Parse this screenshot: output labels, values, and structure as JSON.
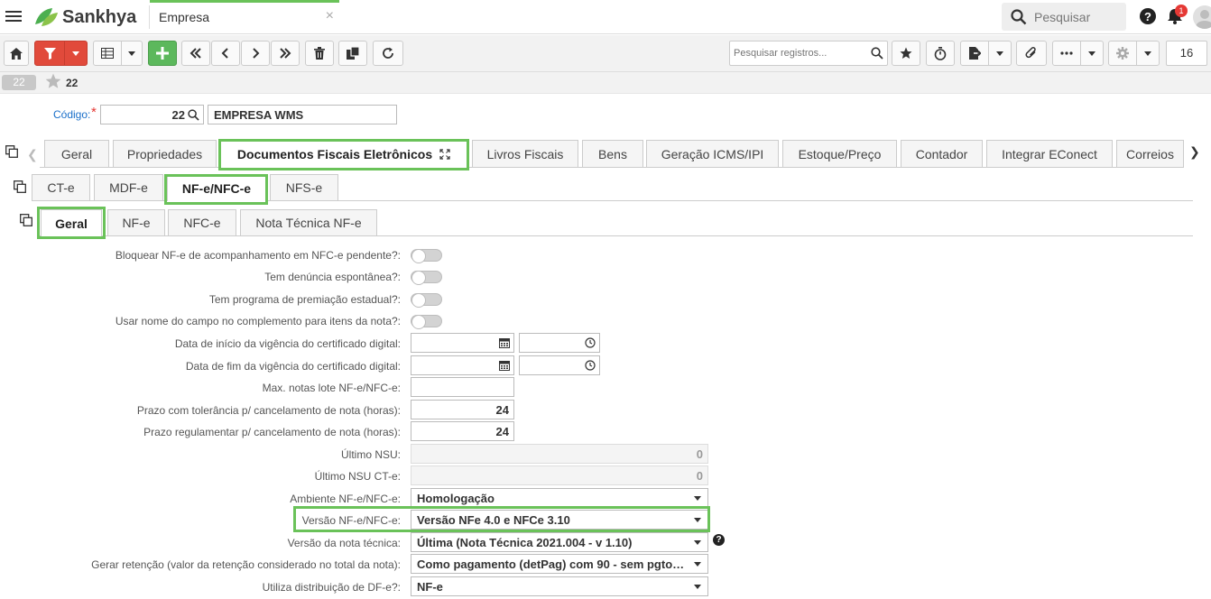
{
  "header": {
    "brand": "Sankhya",
    "page_title": "Empresa",
    "close_glyph": "×",
    "search_placeholder": "Pesquisar",
    "notification_count": "1",
    "accent_color": "#6ac259"
  },
  "toolbar": {
    "record_search_placeholder": "Pesquisar registros...",
    "page_number": "16",
    "icons": [
      "home-icon",
      "filter-icon",
      "grid-icon",
      "add-icon",
      "first-icon",
      "previous-icon",
      "next-icon",
      "last-icon",
      "delete-icon",
      "duplicate-icon",
      "refresh-icon",
      "search-icon",
      "star-icon",
      "timer-icon",
      "export-icon",
      "attachment-icon",
      "more-icon",
      "gear-icon"
    ]
  },
  "record": {
    "badge": "22",
    "favorite_label": "22"
  },
  "codigo": {
    "label": "Código:",
    "required_mark": "*",
    "value": "22",
    "description": "EMPRESA WMS"
  },
  "tabs": {
    "main": [
      "Geral",
      "Propriedades",
      "Documentos Fiscais Eletrônicos",
      "Livros Fiscais",
      "Bens",
      "Geração ICMS/IPI",
      "Estoque/Preço",
      "Contador",
      "Integrar EConect",
      "Correios"
    ],
    "docs": [
      "CT-e",
      "MDF-e",
      "NF-e/NFC-e",
      "NFS-e"
    ],
    "nfe": [
      "Geral",
      "NF-e",
      "NFC-e",
      "Nota Técnica NF-e"
    ]
  },
  "form": {
    "bloquear_label": "Bloquear NF-e de acompanhamento em NFC-e pendente?:",
    "denuncia_label": "Tem denúncia espontânea?:",
    "premiacao_label": "Tem programa de premiação estadual?:",
    "nome_campo_label": "Usar nome do campo no complemento para itens da nota?:",
    "data_inicio_label": "Data de início da vigência do certificado digital:",
    "data_fim_label": "Data de fim da vigência do certificado digital:",
    "max_notas_label": "Max. notas lote NF-e/NFC-e:",
    "prazo_tolerancia_label": "Prazo com tolerância p/ cancelamento de nota (horas):",
    "prazo_tolerancia_value": "24",
    "prazo_regulamentar_label": "Prazo regulamentar p/ cancelamento de nota (horas):",
    "prazo_regulamentar_value": "24",
    "ultimo_nsu_label": "Último NSU:",
    "ultimo_nsu_value": "0",
    "ultimo_nsu_cte_label": "Último NSU CT-e:",
    "ultimo_nsu_cte_value": "0",
    "ambiente_label": "Ambiente NF-e/NFC-e:",
    "ambiente_value": "Homologação",
    "versao_label": "Versão NF-e/NFC-e:",
    "versao_value": "Versão NFe 4.0 e NFCe 3.10",
    "versao_nt_label": "Versão da nota técnica:",
    "versao_nt_value": "Última (Nota Técnica 2021.004 - v 1.10)",
    "retencao_label": "Gerar retenção (valor da retenção considerado no total da nota):",
    "retencao_value": "Como pagamento (detPag) com 90 - sem pgto, ...",
    "distribuicao_label": "Utiliza distribuição de DF-e?:",
    "distribuicao_value": "NF-e",
    "help_glyph": "?"
  }
}
